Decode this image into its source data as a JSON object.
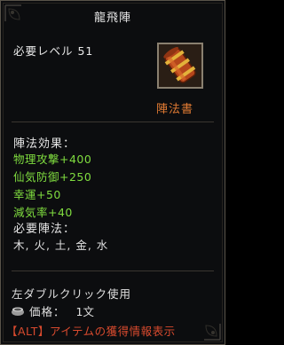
{
  "tooltip": {
    "title": "龍飛陣",
    "level_requirement": "必要レベル 51",
    "item_type": "陣法書",
    "effects_label": "陣法効果：",
    "effects": [
      "物理攻撃+400",
      "仙気防御+250",
      "幸運+50",
      "減気率+40"
    ],
    "required_label": "必要陣法：",
    "required_elements": "木, 火, 土, 金, 水",
    "usage": "左ダブルクリック使用",
    "price_label": "価格：",
    "price_value": "1文",
    "alt_hint": "【ALT】アイテムの獲得情報表示"
  },
  "colors": {
    "stat_green": "#7fdc3f",
    "type_orange": "#e07a33",
    "hint_red": "#d84a2e"
  },
  "icons": {
    "item": "scroll-bundle-icon",
    "price": "coin-pot-icon"
  }
}
